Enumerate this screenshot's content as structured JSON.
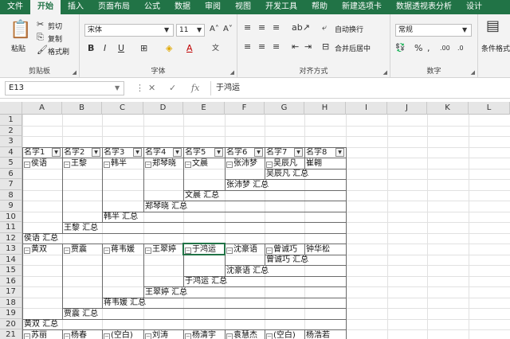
{
  "tabs": [
    {
      "label": "文件"
    },
    {
      "label": "开始"
    },
    {
      "label": "插入"
    },
    {
      "label": "页面布局"
    },
    {
      "label": "公式"
    },
    {
      "label": "数据"
    },
    {
      "label": "审阅"
    },
    {
      "label": "视图"
    },
    {
      "label": "开发工具"
    },
    {
      "label": "帮助"
    },
    {
      "label": "新建选项卡"
    },
    {
      "label": "数据透视表分析"
    },
    {
      "label": "设计"
    }
  ],
  "active_tab": "开始",
  "ribbon": {
    "clipboard": {
      "paste": "粘贴",
      "cut": "剪切",
      "copy": "复制",
      "format_painter": "格式刷",
      "label": "剪贴板"
    },
    "font": {
      "name": "宋体",
      "size": "11",
      "bold": "B",
      "italic": "I",
      "underline": "U",
      "label": "字体"
    },
    "alignment": {
      "wrap": "自动换行",
      "merge": "合并后居中",
      "label": "对齐方式"
    },
    "number": {
      "format": "常规",
      "label": "数字"
    },
    "styles": {
      "conditional": "条件格式"
    }
  },
  "formula_bar": {
    "cell_ref": "E13",
    "formula": "于鸿运"
  },
  "grid": {
    "columns": [
      "A",
      "B",
      "C",
      "D",
      "E",
      "F",
      "G",
      "H",
      "I",
      "J",
      "K",
      "L"
    ],
    "rows": [
      "1",
      "2",
      "3",
      "4",
      "5",
      "6",
      "7",
      "8",
      "9",
      "10",
      "11",
      "12",
      "13",
      "14",
      "15",
      "16",
      "17",
      "18",
      "19",
      "20",
      "21"
    ],
    "headers": [
      "名字1",
      "名字2",
      "名字3",
      "名字4",
      "名字5",
      "名字6",
      "名字7",
      "名字8"
    ],
    "cells": {
      "r5": [
        "侯语",
        "王黎",
        "韩半",
        "郑琴晓",
        "文晨",
        "张沛梦",
        "吴辰凡",
        "崔翱"
      ],
      "r6g": "吴辰凡 汇总",
      "r7f": "张沛梦 汇总",
      "r8e": "文晨 汇总",
      "r9d": "郑琴晓 汇总",
      "r10c": "韩半 汇总",
      "r11b": "王黎 汇总",
      "r12a": "侯语 汇总",
      "r13": [
        "黄双",
        "贾震",
        "蒋韦媛",
        "王翠婷",
        "于鸿运",
        "沈豪语",
        "曾诚巧",
        "钟华松"
      ],
      "r14g": "曾诚巧 汇总",
      "r15f": "沈豪语 汇总",
      "r16e": "于鸿运 汇总",
      "r17d": "王翠婷 汇总",
      "r18c": "蒋韦媛 汇总",
      "r19b": "贾震 汇总",
      "r20a": "黄双 汇总",
      "r21": [
        "苏丽",
        "杨春",
        "(空白)",
        "刘涛",
        "杨清宇",
        "袁慧杰",
        "(空白)",
        "杨浩若"
      ]
    }
  }
}
